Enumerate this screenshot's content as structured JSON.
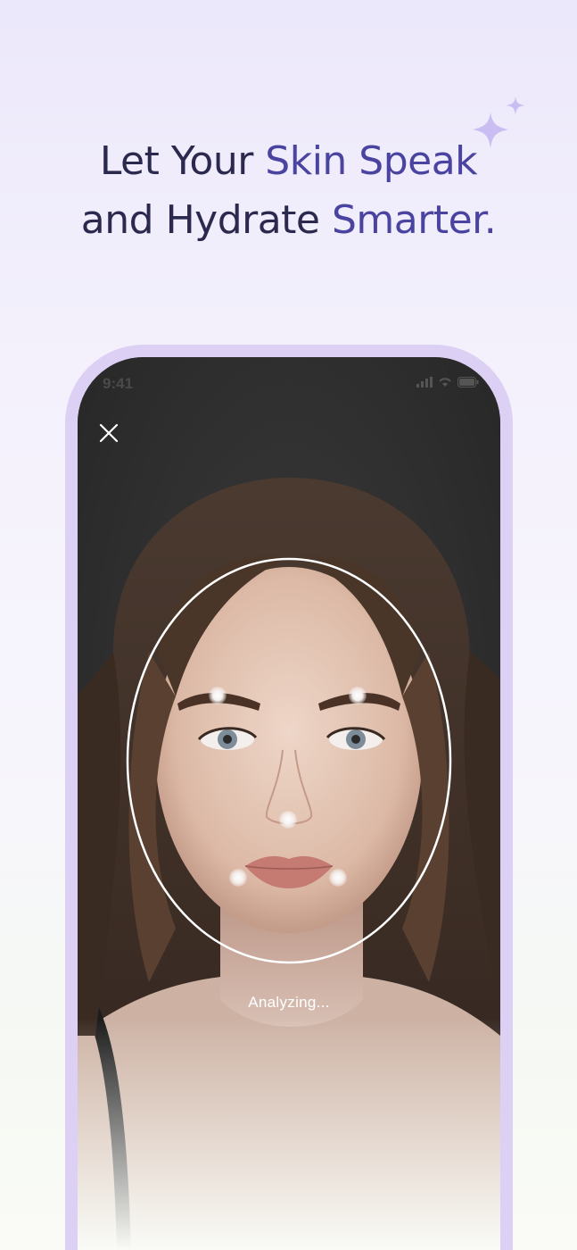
{
  "headline": {
    "line1_plain": "Let Your ",
    "line1_accent": "Skin Speak",
    "line2_plain": "and Hydrate ",
    "line2_accent": "Smarter."
  },
  "phone": {
    "status_time": "9:41",
    "close_icon": "close-icon",
    "status_icons": [
      "signal-icon",
      "wifi-icon",
      "battery-icon"
    ],
    "scan_status": "Analyzing...",
    "landmark_points": 6
  },
  "colors": {
    "headline_dark": "#2b2a4e",
    "headline_accent": "#4a44a0",
    "phone_frame": "#dcd0f4",
    "sparkle": "#c9bdf2"
  }
}
